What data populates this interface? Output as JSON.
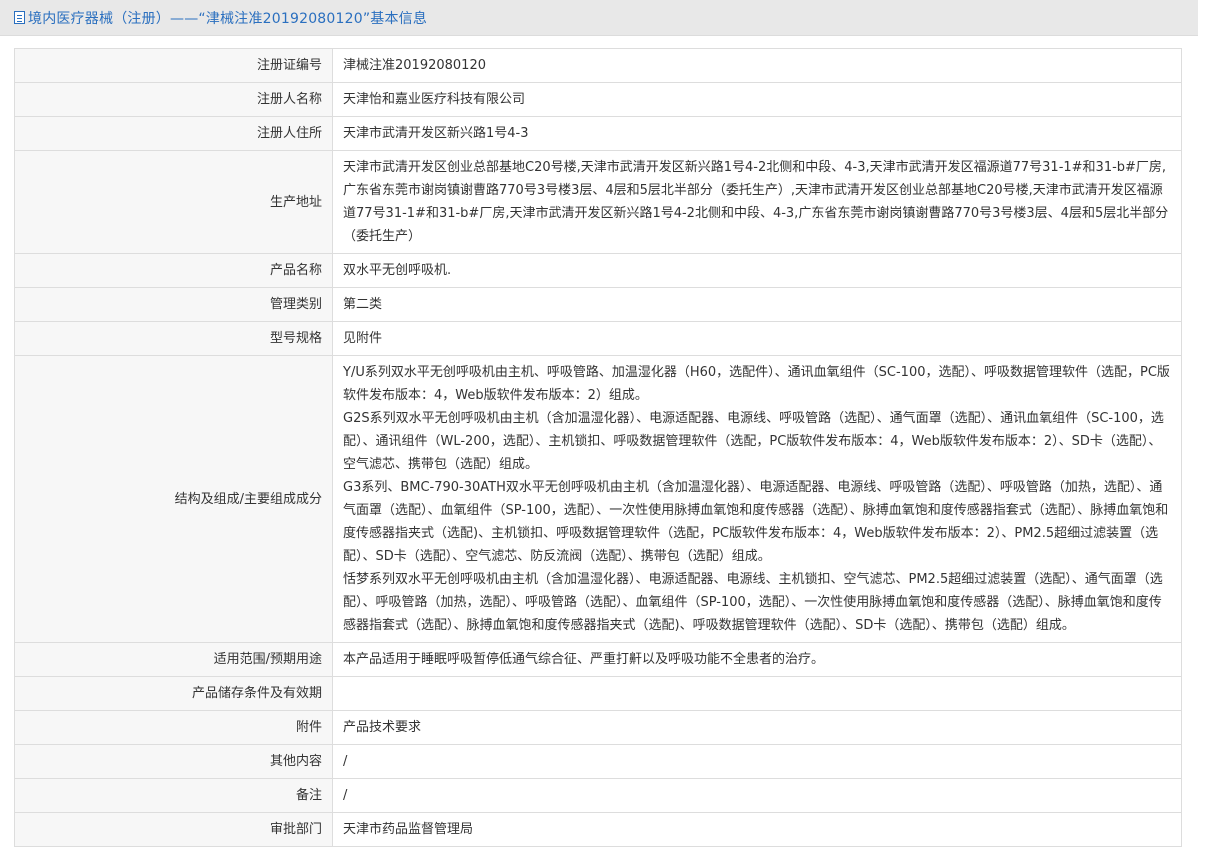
{
  "title": "境内医疗器械（注册）——“津械注准20192080120”基本信息",
  "rows": [
    {
      "label": "注册证编号",
      "value": "津械注准20192080120"
    },
    {
      "label": "注册人名称",
      "value": "天津怡和嘉业医疗科技有限公司"
    },
    {
      "label": "注册人住所",
      "value": "天津市武清开发区新兴路1号4-3"
    },
    {
      "label": "生产地址",
      "value": "天津市武清开发区创业总部基地C20号楼,天津市武清开发区新兴路1号4-2北侧和中段、4-3,天津市武清开发区福源道77号31-1#和31-b#厂房,广东省东莞市谢岗镇谢曹路770号3号楼3层、4层和5层北半部分（委托生产）,天津市武清开发区创业总部基地C20号楼,天津市武清开发区福源道77号31-1#和31-b#厂房,天津市武清开发区新兴路1号4-2北侧和中段、4-3,广东省东莞市谢岗镇谢曹路770号3号楼3层、4层和5层北半部分（委托生产）"
    },
    {
      "label": "产品名称",
      "value": "双水平无创呼吸机."
    },
    {
      "label": "管理类别",
      "value": "第二类"
    },
    {
      "label": "型号规格",
      "value": "见附件"
    },
    {
      "label": "结构及组成/主要组成成分",
      "paragraphs": [
        "Y/U系列双水平无创呼吸机由主机、呼吸管路、加温湿化器（H60，选配件）、通讯血氧组件（SC-100，选配）、呼吸数据管理软件（选配，PC版软件发布版本：4，Web版软件发布版本：2）组成。",
        "G2S系列双水平无创呼吸机由主机（含加温湿化器）、电源适配器、电源线、呼吸管路（选配）、通气面罩（选配）、通讯血氧组件（SC-100，选配）、通讯组件（WL-200，选配）、主机锁扣、呼吸数据管理软件（选配，PC版软件发布版本：4，Web版软件发布版本：2）、SD卡（选配）、空气滤芯、携带包（选配）组成。",
        "G3系列、BMC-790-30ATH双水平无创呼吸机由主机（含加温湿化器）、电源适配器、电源线、呼吸管路（选配）、呼吸管路（加热，选配）、通气面罩（选配）、血氧组件（SP-100，选配）、一次性使用脉搏血氧饱和度传感器（选配）、脉搏血氧饱和度传感器指套式（选配）、脉搏血氧饱和度传感器指夹式（选配)、主机锁扣、呼吸数据管理软件（选配，PC版软件发布版本：4，Web版软件发布版本：2）、PM2.5超细过滤装置（选配）、SD卡（选配）、空气滤芯、防反流阀（选配）、携带包（选配）组成。",
        "恬梦系列双水平无创呼吸机由主机（含加温湿化器）、电源适配器、电源线、主机锁扣、空气滤芯、PM2.5超细过滤装置（选配）、通气面罩（选配）、呼吸管路（加热，选配）、呼吸管路（选配）、血氧组件（SP-100，选配）、一次性使用脉搏血氧饱和度传感器（选配）、脉搏血氧饱和度传感器指套式（选配）、脉搏血氧饱和度传感器指夹式（选配)、呼吸数据管理软件（选配）、SD卡（选配）、携带包（选配）组成。"
      ]
    },
    {
      "label": "适用范围/预期用途",
      "value": "本产品适用于睡眠呼吸暂停低通气综合征、严重打鼾以及呼吸功能不全患者的治疗。"
    },
    {
      "label": "产品储存条件及有效期",
      "value": ""
    },
    {
      "label": "附件",
      "value": "产品技术要求"
    },
    {
      "label": "其他内容",
      "value": "/"
    },
    {
      "label": "备注",
      "value": "/"
    },
    {
      "label": "审批部门",
      "value": "天津市药品监督管理局"
    }
  ]
}
